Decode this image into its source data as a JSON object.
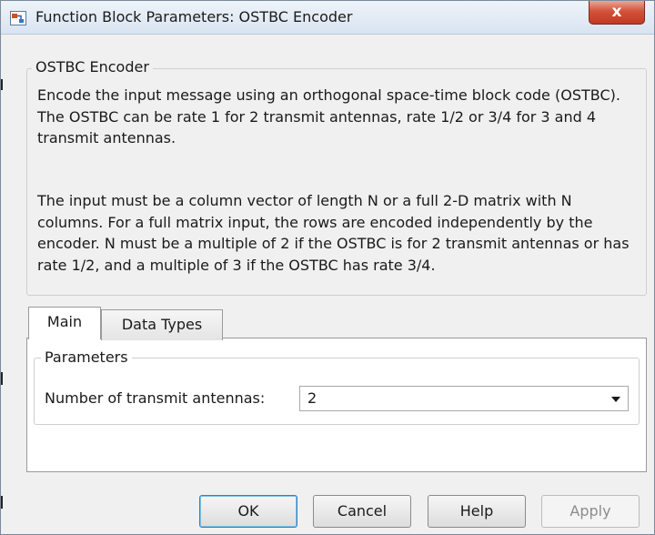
{
  "window": {
    "title": "Function Block Parameters: OSTBC Encoder",
    "close_glyph": "x"
  },
  "description": {
    "group_title": "OSTBC Encoder",
    "paragraph1": "Encode the input message using an orthogonal space-time block code (OSTBC). The OSTBC can be rate 1 for 2 transmit antennas, rate 1/2 or 3/4 for 3 and 4 transmit antennas.",
    "paragraph2": "The input must be a column vector of length N or a full 2-D matrix with N columns. For a full matrix input, the rows are encoded independently by the encoder. N must be a multiple of 2 if the OSTBC is for 2 transmit antennas or has rate 1/2, and a multiple of 3 if the OSTBC has rate 3/4."
  },
  "tabs": [
    {
      "label": "Main",
      "active": true
    },
    {
      "label": "Data Types",
      "active": false
    }
  ],
  "parameters": {
    "group_title": "Parameters",
    "transmit_antennas": {
      "label": "Number of transmit antennas:",
      "value": "2"
    }
  },
  "buttons": {
    "ok": "OK",
    "cancel": "Cancel",
    "help": "Help",
    "apply": "Apply"
  },
  "colors": {
    "close_button": "#c8432b",
    "default_button_border": "#3c7fb1",
    "disabled_text": "#8c8c8c"
  },
  "icons": {
    "app": "simulink-block-icon",
    "dropdown": "chevron-down-icon"
  }
}
